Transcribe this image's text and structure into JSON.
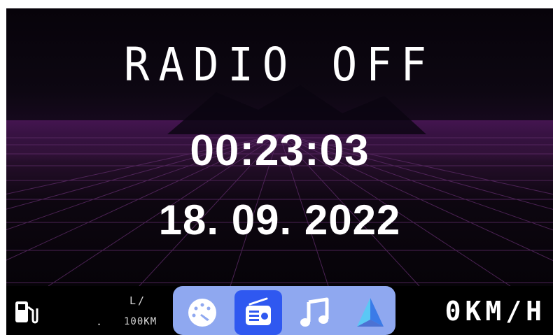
{
  "radio": {
    "status": "RADIO OFF"
  },
  "clock": {
    "time": "00:23:03",
    "date": "18. 09. 2022"
  },
  "statusbar": {
    "fuel": {
      "icon": "fuel-pump-icon",
      "unit": "L/",
      "value": ".",
      "distance": "100KM"
    },
    "dock": [
      {
        "name": "speedometer-app",
        "icon": "gauge-icon",
        "active": false
      },
      {
        "name": "radio-app",
        "icon": "radio-icon",
        "active": true
      },
      {
        "name": "music-app",
        "icon": "music-note-icon",
        "active": false
      },
      {
        "name": "navigation-app",
        "icon": "navigation-arrow-icon",
        "active": false
      }
    ],
    "speed": "0KM/H"
  },
  "colors": {
    "dock_bg": "#8fa8f0",
    "dock_active": "#2f58f0",
    "text": "#ffffff",
    "background": "#000000"
  }
}
